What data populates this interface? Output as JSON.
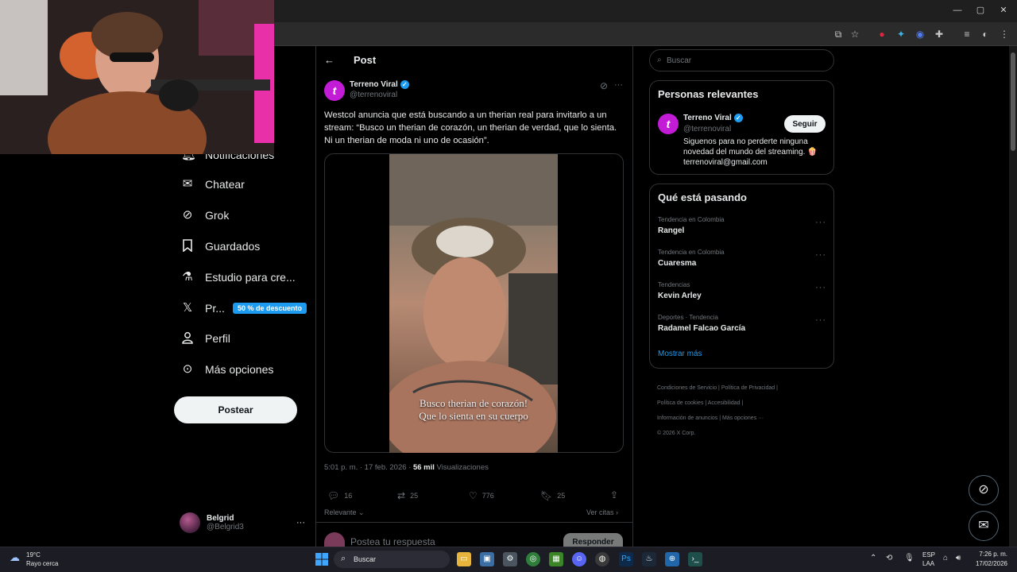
{
  "browser": {
    "window_controls": {
      "minimize": "—",
      "maximize": "▢",
      "close": "✕"
    }
  },
  "nav": {
    "items": [
      {
        "key": "notifications",
        "label": "Notificaciones",
        "icon": "bell-icon"
      },
      {
        "key": "chat",
        "label": "Chatear",
        "icon": "mail-icon"
      },
      {
        "key": "grok",
        "label": "Grok",
        "icon": "grok-icon"
      },
      {
        "key": "bookmarks",
        "label": "Guardados",
        "icon": "bookmark-icon"
      },
      {
        "key": "studio",
        "label": "Estudio para cre...",
        "icon": "flask-icon"
      },
      {
        "key": "premium",
        "label": "Pr...",
        "icon": "x-logo-icon"
      },
      {
        "key": "profile",
        "label": "Perfil",
        "icon": "person-icon"
      },
      {
        "key": "more",
        "label": "Más opciones",
        "icon": "more-circle-icon"
      }
    ],
    "premium_badge": "50 % de descuento",
    "post_button": "Postear",
    "account": {
      "name": "Belgrid",
      "handle": "@Belgrid3",
      "more": "···"
    }
  },
  "post": {
    "header_title": "Post",
    "back": "←",
    "author": {
      "name": "Terreno Viral",
      "handle": "@terrenoviral",
      "avatar_letter": "t"
    },
    "more": "···",
    "text": "Westcol anuncia que está buscando a un therian real para invitarlo a un stream: “Busco un therian de corazón, un therian de verdad, que lo sienta. Ni un therian de moda ni uno de ocasión”.",
    "video_caption_line1": "Busco therian de corazón!",
    "video_caption_line2": "Que lo sienta en su cuerpo",
    "time": "5:01 p. m. · 17 feb. 2026 · ",
    "views_count": "56 mil",
    "views_label": " Visualizaciones",
    "actions": {
      "replies": "16",
      "reposts": "25",
      "likes": "776",
      "bookmarks": "25"
    },
    "sort_label": "Relevante",
    "quotes_label": "Ver citas",
    "reply_placeholder": "Postea tu respuesta",
    "reply_button": "Responder"
  },
  "sidebar": {
    "search_placeholder": "Buscar",
    "relevant": {
      "title": "Personas relevantes",
      "name": "Terreno Viral",
      "handle": "@terrenoviral",
      "follow": "Seguir",
      "bio": "Siguenos para no perderte ninguna novedad del mundo del streaming. 🍿 terrenoviral@gmail.com"
    },
    "trends": {
      "title": "Qué está pasando",
      "items": [
        {
          "category": "Tendencia en Colombia",
          "name": "Rangel"
        },
        {
          "category": "Tendencia en Colombia",
          "name": "Cuaresma"
        },
        {
          "category": "Tendencias",
          "name": "Kevin Arley"
        },
        {
          "category": "Deportes · Tendencia",
          "name": "Radamel Falcao García"
        }
      ],
      "more_dots": "···",
      "show_more": "Mostrar más"
    },
    "footer": {
      "terms": "Condiciones de Servicio",
      "privacy": "Política de Privacidad",
      "cookies": "Política de cookies",
      "accessibility": "Accesibilidad",
      "ads": "Información de anuncios",
      "more": "Más opciones ···",
      "copyright": "© 2026 X Corp."
    }
  },
  "taskbar": {
    "weather_temp": "19°C",
    "weather_desc": "Rayo cerca",
    "search_placeholder": "Buscar",
    "lang_top": "ESP",
    "lang_bottom": "LAA",
    "time": "7:26 p. m.",
    "date": "17/02/2026"
  },
  "colors": {
    "accent": "#1d9bf0",
    "background": "#000000",
    "border": "#2f3336",
    "muted": "#71767b",
    "brand_avatar": "#c21cd6"
  }
}
